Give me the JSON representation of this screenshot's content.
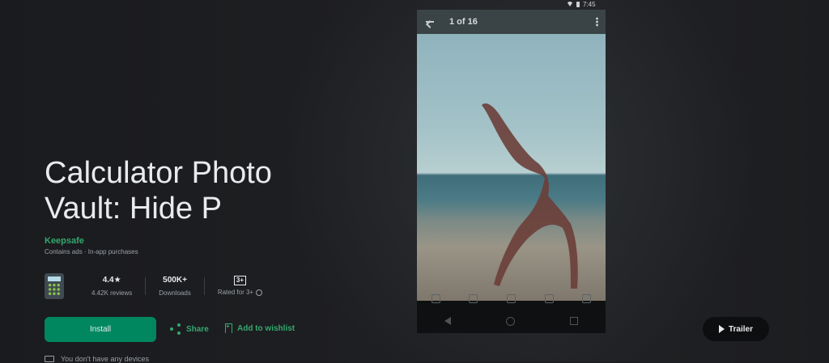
{
  "app": {
    "title": "Calculator Photo Vault: Hide P",
    "developer": "Keepsafe",
    "ads_note": "Contains ads · In-app purchases"
  },
  "stats": {
    "rating": "4.4",
    "rating_star": "★",
    "reviews": "4.42K reviews",
    "downloads": "500K+",
    "downloads_label": "Downloads",
    "content_rating_badge": "3+",
    "content_rating_label": "Rated for 3+"
  },
  "actions": {
    "install": "Install",
    "share": "Share",
    "wishlist": "Add to wishlist",
    "trailer": "Trailer"
  },
  "devices_note": "You don't have any devices",
  "screenshot": {
    "status_time": "7:45",
    "counter": "1 of 16"
  },
  "colors": {
    "accent": "#01875f",
    "accent_text": "#34a86f",
    "background": "#1b1c1f"
  },
  "icons": [
    "back-arrow-icon",
    "more-vert-icon",
    "share-icon",
    "bookmark-add-icon",
    "play-icon",
    "info-icon",
    "laptop-icon",
    "calculator-app-icon"
  ]
}
